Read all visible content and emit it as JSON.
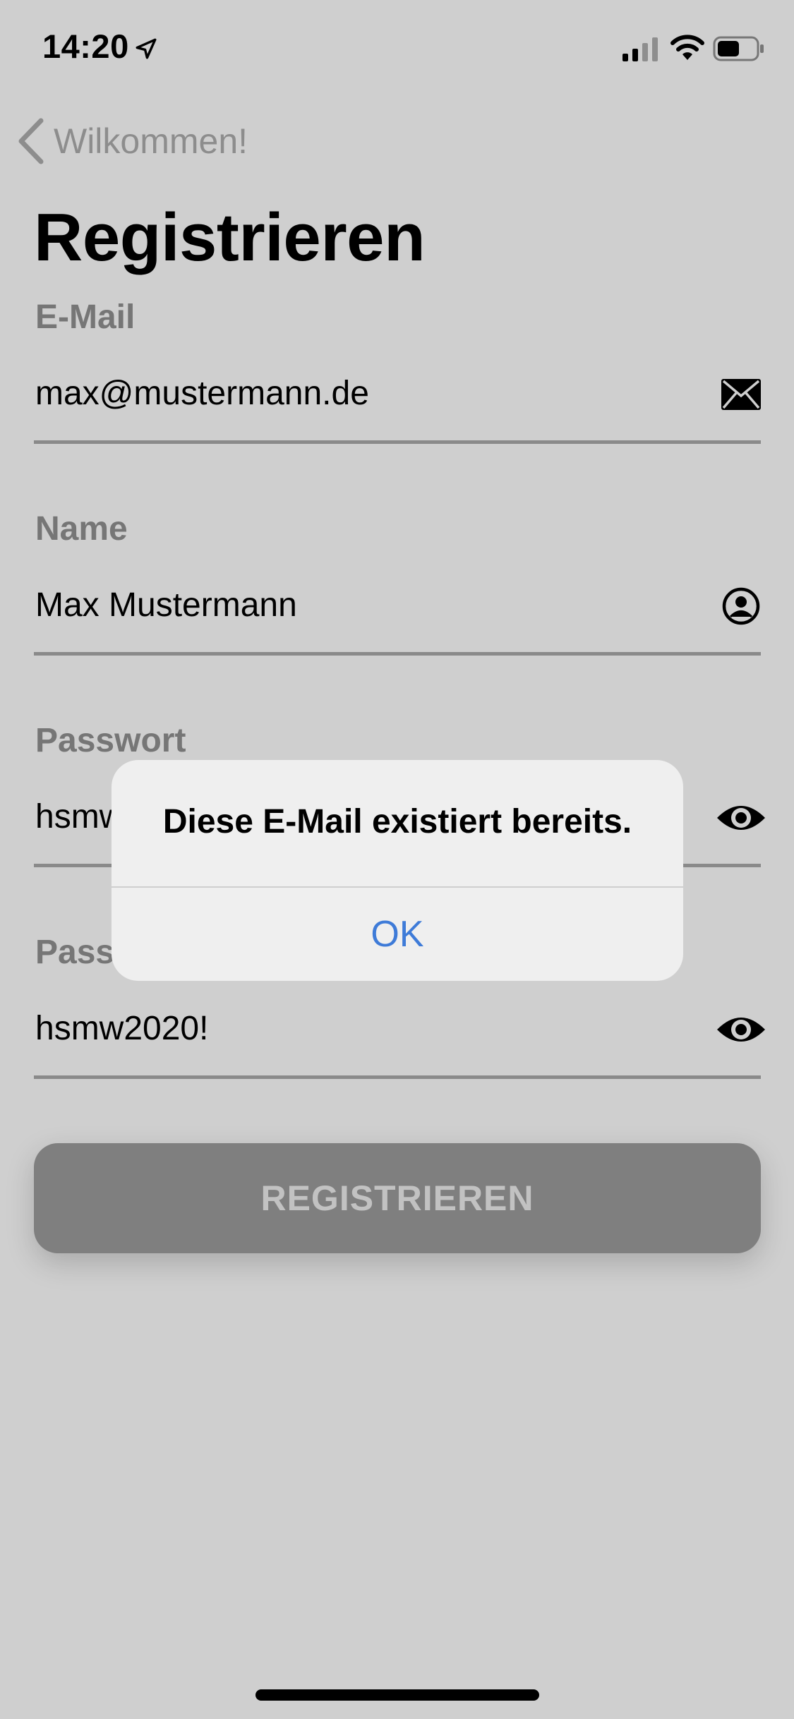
{
  "status_bar": {
    "time": "14:20",
    "icons": [
      "location-arrow-icon",
      "signal-icon",
      "wifi-icon",
      "battery-icon"
    ]
  },
  "nav": {
    "back_label": "Wilkommen!",
    "back_icon": "chevron-left-icon"
  },
  "page": {
    "title": "Registrieren"
  },
  "form": {
    "email": {
      "label": "E-Mail",
      "value": "max@mustermann.de",
      "icon": "envelope-icon"
    },
    "name": {
      "label": "Name",
      "value": "Max Mustermann",
      "icon": "user-circle-icon"
    },
    "password": {
      "label": "Passwort",
      "value": "hsmw2020!",
      "icon": "eye-icon"
    },
    "password_confirm": {
      "label": "Passwort",
      "value": "hsmw2020!",
      "icon": "eye-icon"
    }
  },
  "register_button": {
    "label": "REGISTRIEREN"
  },
  "alert": {
    "message": "Diese E-Mail existiert bereits.",
    "ok_label": "OK"
  },
  "colors": {
    "background": "#cfcfcf",
    "alert_background": "#efefef",
    "alert_action": "#3e7bd8",
    "button": "#7f7f7f",
    "label": "#767676"
  }
}
